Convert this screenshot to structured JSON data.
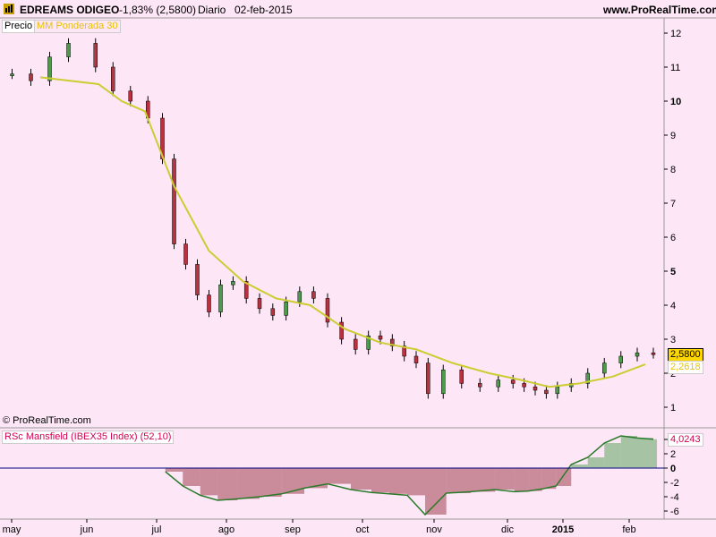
{
  "header": {
    "ticker": "EDREAMS ODIGEO",
    "change": "-1,83% (2,5800)",
    "period": "Diario",
    "date": "02-feb-2015",
    "site": "www.ProRealTime.com"
  },
  "copyright": "© ProRealTime.com",
  "legend": {
    "price_label": "Precio",
    "ma_label": "MM Ponderada 30",
    "ind_label": "RSc Mansfield (IBEX35 Index) (52,10)"
  },
  "price_box": {
    "last": "2,5800",
    "ma": "2,2618"
  },
  "ind_box": "4,0243",
  "colors": {
    "background": "#fde7f7",
    "ma_line": "#cccc33",
    "last_price_box": "#ffd700",
    "ma_box_text": "#e6c200",
    "legend_text": "#d40050",
    "ind_positive_fill": "#5fa860",
    "ind_negative_fill": "#a04050",
    "zero_line": "#000080"
  },
  "chart_data": [
    {
      "type": "candlestick",
      "title": "EDREAMS ODIGEO",
      "y_ticks": [
        "1",
        "2",
        "3",
        "4",
        "5",
        "6",
        "7",
        "8",
        "9",
        "10",
        "11",
        "12"
      ],
      "y_bold_ticks": [
        "5",
        "10"
      ],
      "x_month_labels": [
        "may",
        "jun",
        "jul",
        "ago",
        "sep",
        "oct",
        "nov",
        "dic",
        "2015",
        "feb"
      ],
      "ylim": [
        0.5,
        12.6
      ],
      "scale": "linear",
      "series": [
        {
          "name": "Precio",
          "points": [
            [
              "may",
              10.8
            ],
            [
              "may",
              10.6
            ],
            [
              "may",
              11.3
            ],
            [
              "may",
              11.7
            ],
            [
              "jun",
              11.0
            ],
            [
              "jun",
              10.3
            ],
            [
              "jun",
              10.0
            ],
            [
              "jun",
              9.5
            ],
            [
              "jul",
              8.3
            ],
            [
              "jul",
              5.8
            ],
            [
              "jul",
              5.2
            ],
            [
              "jul",
              4.3
            ],
            [
              "jul",
              3.8
            ],
            [
              "jul",
              4.6
            ],
            [
              "ago",
              4.7
            ],
            [
              "ago",
              4.2
            ],
            [
              "ago",
              3.9
            ],
            [
              "ago",
              3.7
            ],
            [
              "ago",
              4.1
            ],
            [
              "sep",
              4.4
            ],
            [
              "sep",
              4.2
            ],
            [
              "sep",
              3.5
            ],
            [
              "sep",
              3.0
            ],
            [
              "sep",
              2.7
            ],
            [
              "oct",
              3.1
            ],
            [
              "oct",
              3.0
            ],
            [
              "oct",
              2.8
            ],
            [
              "oct",
              2.5
            ],
            [
              "oct",
              2.3
            ],
            [
              "oct",
              1.4
            ],
            [
              "nov",
              2.1
            ],
            [
              "nov",
              1.7
            ],
            [
              "nov",
              1.6
            ],
            [
              "nov",
              1.8
            ],
            [
              "dic",
              1.7
            ],
            [
              "dic",
              1.6
            ],
            [
              "dic",
              1.5
            ],
            [
              "dic",
              1.4
            ],
            [
              "dic",
              1.6
            ],
            [
              "2015",
              1.7
            ],
            [
              "2015",
              2.0
            ],
            [
              "2015",
              2.3
            ],
            [
              "2015",
              2.5
            ],
            [
              "feb",
              2.6
            ],
            [
              "feb",
              2.58
            ]
          ]
        },
        {
          "name": "MM Ponderada 30",
          "points": [
            [
              "may",
              10.7
            ],
            [
              "jun",
              10.5
            ],
            [
              "jun",
              10.0
            ],
            [
              "jun",
              9.7
            ],
            [
              "jul",
              7.5
            ],
            [
              "jul",
              5.6
            ],
            [
              "ago",
              4.7
            ],
            [
              "ago",
              4.2
            ],
            [
              "sep",
              4.0
            ],
            [
              "sep",
              3.3
            ],
            [
              "oct",
              2.9
            ],
            [
              "oct",
              2.7
            ],
            [
              "nov",
              2.3
            ],
            [
              "nov",
              2.0
            ],
            [
              "dic",
              1.8
            ],
            [
              "dic",
              1.6
            ],
            [
              "2015",
              1.7
            ],
            [
              "2015",
              1.9
            ],
            [
              "feb",
              2.2618
            ]
          ]
        }
      ],
      "last_price": 2.58,
      "ma_last": 2.2618
    },
    {
      "type": "area",
      "title": "RSc Mansfield (IBEX35 Index) (52,10)",
      "y_ticks": [
        "4",
        "2",
        "0",
        "-2",
        "-4",
        "-6"
      ],
      "y_bold_ticks": [
        "0"
      ],
      "ylim": [
        -6.8,
        5.6
      ],
      "zero_line": 0,
      "series": [
        {
          "name": "RSc Mansfield",
          "points": [
            [
              "jul",
              -0.5
            ],
            [
              "jul",
              -2.5
            ],
            [
              "jul",
              -3.8
            ],
            [
              "jul",
              -4.5
            ],
            [
              "ago",
              -4.3
            ],
            [
              "ago",
              -4.0
            ],
            [
              "ago",
              -3.6
            ],
            [
              "sep",
              -2.8
            ],
            [
              "sep",
              -2.2
            ],
            [
              "sep",
              -3.0
            ],
            [
              "oct",
              -3.4
            ],
            [
              "oct",
              -3.6
            ],
            [
              "oct",
              -3.8
            ],
            [
              "oct",
              -6.5
            ],
            [
              "nov",
              -3.5
            ],
            [
              "nov",
              -3.3
            ],
            [
              "nov",
              -3.0
            ],
            [
              "dic",
              -3.3
            ],
            [
              "dic",
              -3.2
            ],
            [
              "dic",
              -2.9
            ],
            [
              "dic",
              -2.5
            ],
            [
              "2015",
              0.5
            ],
            [
              "2015",
              1.5
            ],
            [
              "2015",
              3.5
            ],
            [
              "2015",
              4.5
            ],
            [
              "feb",
              4.2
            ],
            [
              "feb",
              4.0243
            ]
          ]
        }
      ],
      "last_value": 4.0243
    }
  ]
}
